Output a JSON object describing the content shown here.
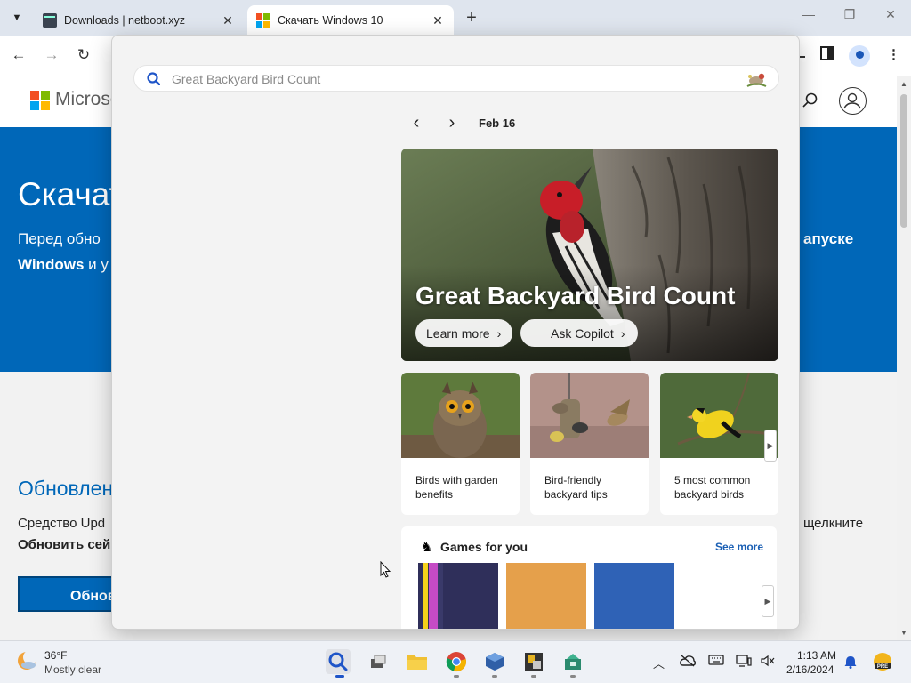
{
  "browser": {
    "tabs": [
      {
        "title": "Downloads | netboot.xyz",
        "active": false,
        "icon": "terminal-favicon"
      },
      {
        "title": "Скачать Windows 10",
        "active": true,
        "icon": "microsoft-favicon"
      }
    ],
    "tab_close": "✕",
    "new_tab": "+",
    "window_controls": {
      "minimize": "—",
      "restore": "❐",
      "close": "✕"
    },
    "nav": {
      "back": "←",
      "forward": "→",
      "reload": "↻"
    }
  },
  "page": {
    "brand": "Microsoft",
    "hero_title": "Скачат",
    "hero_text_1": "Перед обно",
    "hero_text_2a": "Windows",
    "hero_text_2b": " и у",
    "hero_text_right": "апуске",
    "update_heading": "Обновлен",
    "update_text": "Средство Upd",
    "update_bold": "Обновить сей",
    "update_right": "щелкните",
    "update_button": "Обнов"
  },
  "flyout": {
    "search_placeholder": "Great Backyard Bird Count",
    "date": "Feb 16",
    "hero": {
      "title": "Great Backyard Bird Count",
      "learn_more": "Learn more",
      "ask_copilot": "Ask Copilot"
    },
    "cards": [
      {
        "caption": "Birds with garden benefits"
      },
      {
        "caption": "Bird-friendly backyard tips"
      },
      {
        "caption": "5 most common backyard birds"
      }
    ],
    "games": {
      "title": "Games for you",
      "see_more": "See more"
    },
    "colors": {
      "accent": "#1a5fb4",
      "ms_blue": "#0067b8"
    }
  },
  "taskbar": {
    "weather_temp": "36°F",
    "weather_desc": "Mostly clear",
    "time": "1:13 AM",
    "date": "2/16/2024",
    "apps": [
      "search-icon",
      "task-view-icon",
      "file-explorer-icon",
      "chrome-icon",
      "virtualbox-icon",
      "dosbox-icon",
      "app-icon"
    ]
  }
}
